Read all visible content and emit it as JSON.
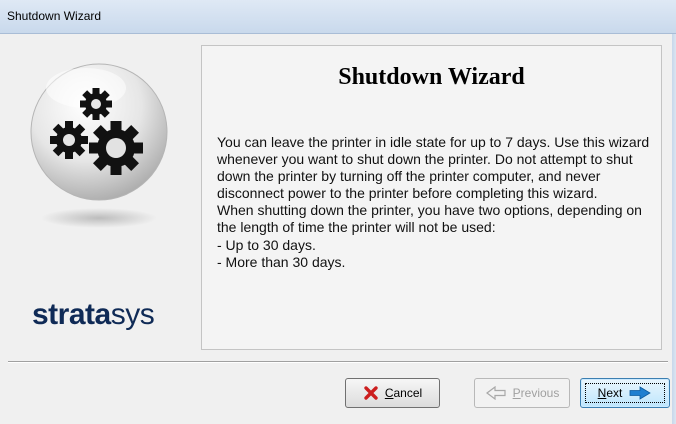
{
  "window": {
    "title": "Shutdown Wizard"
  },
  "sidebar": {
    "logo_bold": "strata",
    "logo_light": "sys"
  },
  "content": {
    "heading": "Shutdown Wizard",
    "paragraph_1": "You can leave the printer in idle state for up to 7 days. Use this wizard whenever you want to shut down the printer. Do not attempt to shut down the printer by turning off the printer computer, and never disconnect power to the printer before completing this wizard.",
    "paragraph_2": "When shutting down the printer, you have two options, depending on the length of time the printer will not be used:",
    "options": [
      "- Up to 30 days.",
      "- More than 30 days."
    ]
  },
  "buttons": {
    "cancel": {
      "mnemonic": "C",
      "rest": "ancel",
      "icon": "x-icon",
      "enabled": true
    },
    "previous": {
      "mnemonic": "P",
      "rest": "revious",
      "icon": "arrow-left-icon",
      "enabled": false
    },
    "next": {
      "mnemonic": "N",
      "rest": "ext",
      "icon": "arrow-right-icon",
      "enabled": true,
      "default": true
    }
  },
  "colors": {
    "logo": "#0f2a56",
    "cancel_icon": "#cc1e1e",
    "next_arrow": "#1f7fd0"
  }
}
